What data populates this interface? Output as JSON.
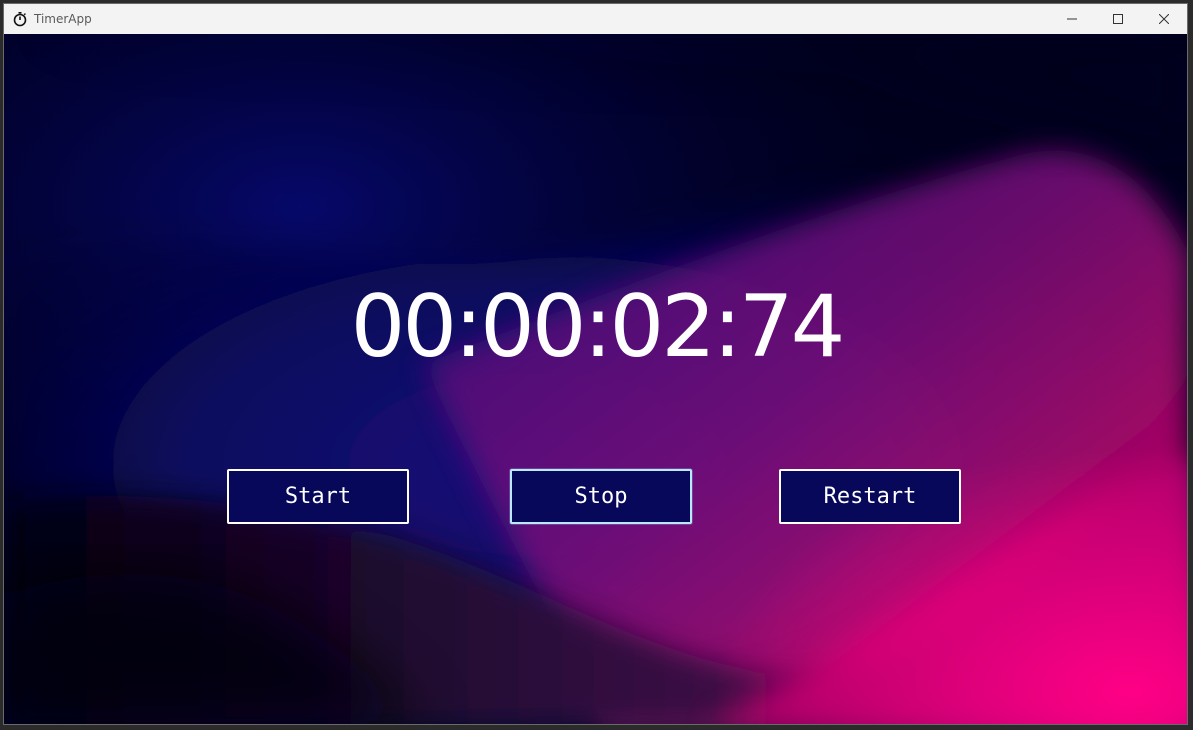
{
  "window": {
    "title": "TimerApp",
    "controls": {
      "minimize_icon": "minimize-icon",
      "maximize_icon": "maximize-icon",
      "close_icon": "close-icon"
    }
  },
  "timer": {
    "display": "00:00:02:74"
  },
  "buttons": {
    "start_label": "Start",
    "stop_label": "Stop",
    "restart_label": "Restart"
  },
  "colors": {
    "background_dark": "#00001e",
    "background_blue": "#0c0a6e",
    "background_magenta": "#ff007f",
    "button_fill": "#07085a",
    "button_border": "#ffffff",
    "text": "#ffffff"
  }
}
